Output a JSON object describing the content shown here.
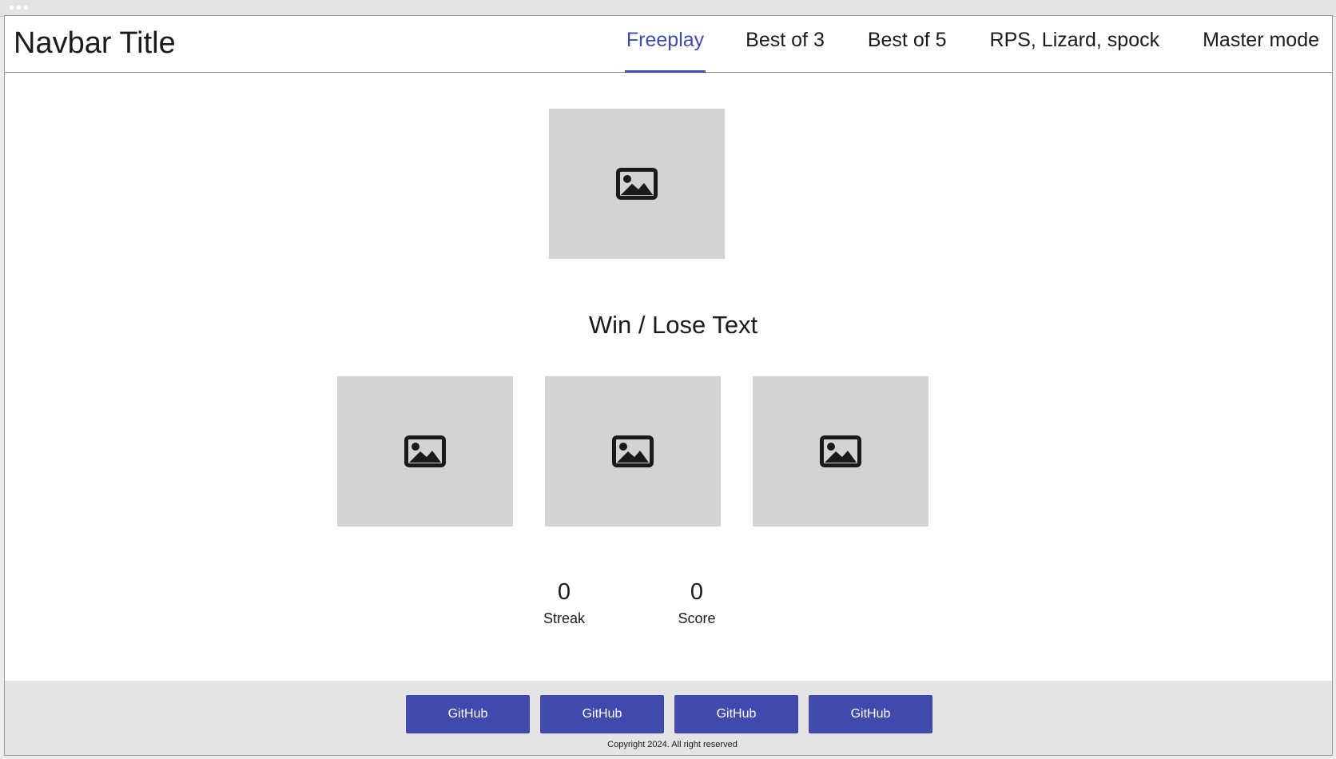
{
  "navbar": {
    "title": "Navbar Title",
    "tabs": [
      {
        "label": "Freeplay",
        "active": true
      },
      {
        "label": "Best of 3",
        "active": false
      },
      {
        "label": "Best of 5",
        "active": false
      },
      {
        "label": "RPS, Lizard, spock",
        "active": false
      },
      {
        "label": "Master mode",
        "active": false
      }
    ]
  },
  "game": {
    "opponent_image_icon": "image-placeholder-icon",
    "result_text": "Win / Lose Text",
    "choices": [
      {
        "icon": "image-placeholder-icon"
      },
      {
        "icon": "image-placeholder-icon"
      },
      {
        "icon": "image-placeholder-icon"
      }
    ]
  },
  "stats": {
    "streak": {
      "value": "0",
      "label": "Streak"
    },
    "score": {
      "value": "0",
      "label": "Score"
    }
  },
  "footer": {
    "buttons": [
      "GitHub",
      "GitHub",
      "GitHub",
      "GitHub"
    ],
    "copyright": "Copyright 2024.  All right reserved"
  },
  "colors": {
    "accent": "#3f4aad",
    "placeholder": "#d3d3d3",
    "footer_bg": "#e4e4e4"
  }
}
